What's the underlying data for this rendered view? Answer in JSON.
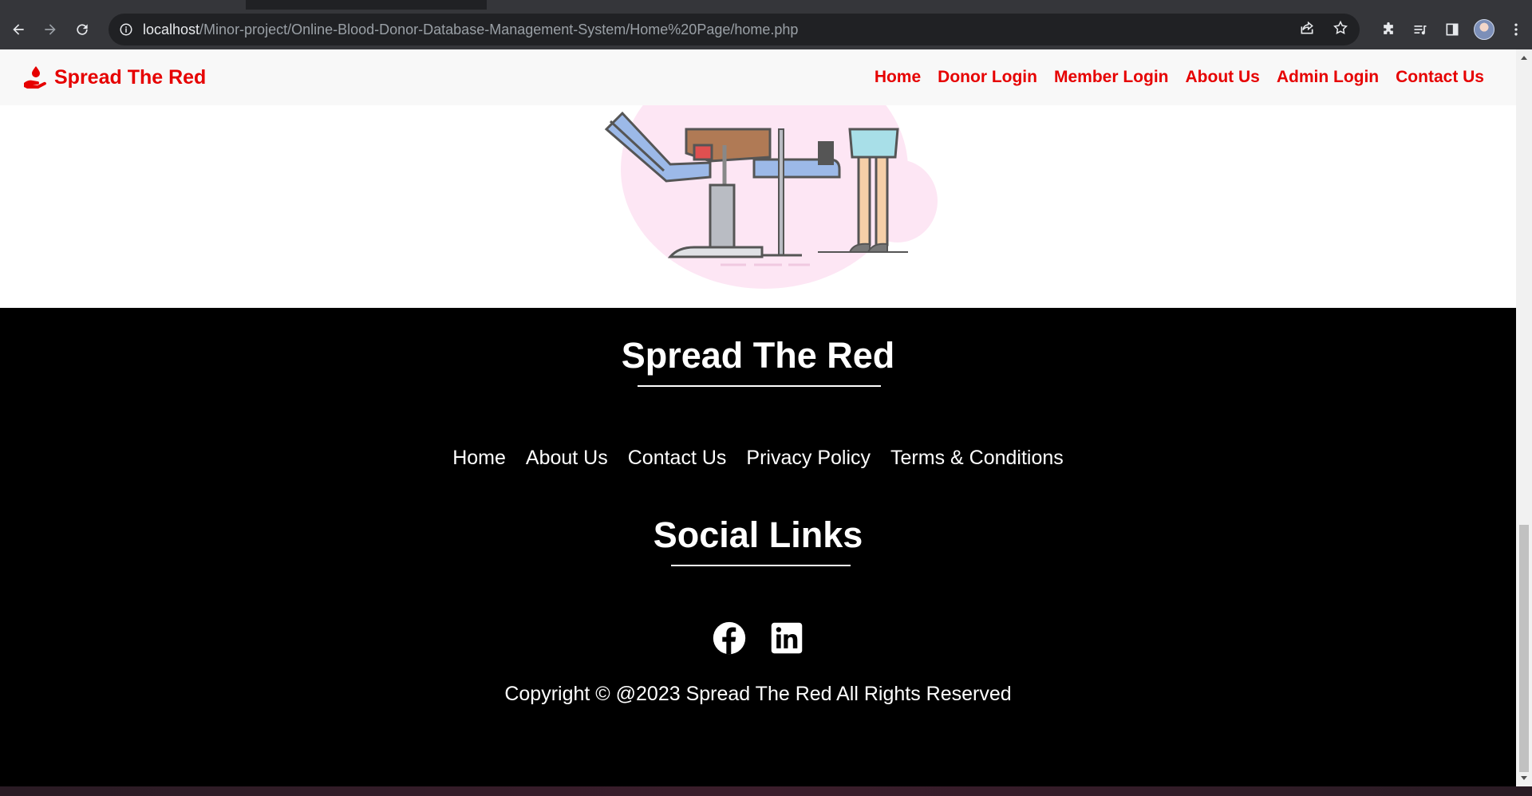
{
  "browser": {
    "url_host": "localhost",
    "url_path": "/Minor-project/Online-Blood-Donor-Database-Management-System/Home%20Page/home.php",
    "icons": [
      "back-arrow-icon",
      "forward-arrow-icon",
      "reload-icon",
      "info-icon",
      "share-icon",
      "star-icon",
      "extensions-icon",
      "media-queue-icon",
      "side-panel-icon",
      "profile-avatar",
      "more-menu-icon"
    ]
  },
  "navbar": {
    "brand": "Spread The Red",
    "links": [
      "Home",
      "Donor Login",
      "Member Login",
      "About Us",
      "Admin Login",
      "Contact Us"
    ]
  },
  "footer": {
    "title": "Spread The Red",
    "links": [
      "Home",
      "About Us",
      "Contact Us",
      "Privacy Policy",
      "Terms & Conditions"
    ],
    "social_title": "Social Links",
    "social_icons": [
      "facebook-icon",
      "linkedin-icon"
    ],
    "copyright": "Copyright © @2023 Spread The Red All Rights Reserved"
  },
  "colors": {
    "brand_red": "#e60000",
    "navbar_bg": "#f8f8f8",
    "footer_bg": "#000000",
    "chrome_toolbar": "#35363a"
  }
}
